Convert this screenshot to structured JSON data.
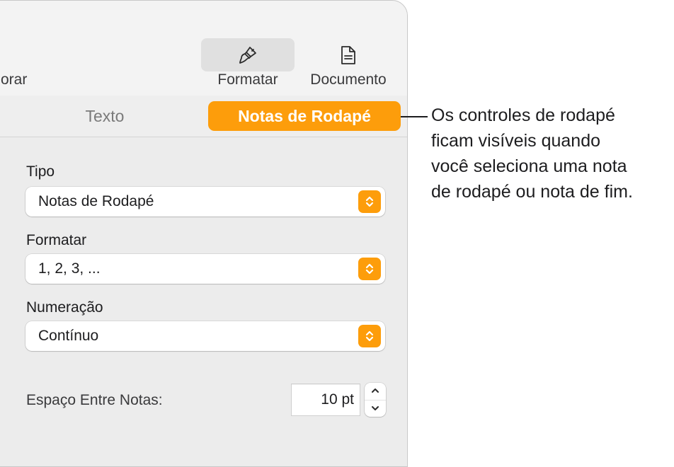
{
  "toolbar": {
    "partial_label": "orar",
    "buttons": [
      {
        "label": "Formatar",
        "icon": "paintbrush-icon",
        "active": true
      },
      {
        "label": "Documento",
        "icon": "document-icon",
        "active": false
      }
    ]
  },
  "tabs": [
    {
      "label": "Texto",
      "active": false
    },
    {
      "label": "Notas de Rodapé",
      "active": true
    }
  ],
  "fields": {
    "tipo": {
      "label": "Tipo",
      "value": "Notas de Rodapé"
    },
    "formatar": {
      "label": "Formatar",
      "value": "1, 2, 3, ..."
    },
    "numeracao": {
      "label": "Numeração",
      "value": "Contínuo"
    }
  },
  "spacing": {
    "label": "Espaço Entre Notas:",
    "value": "10 pt"
  },
  "callout": {
    "text": "Os controles de rodapé\nficam visíveis quando\nvocê seleciona uma nota\nde rodapé ou nota de fim."
  },
  "colors": {
    "accent": "#fd9d0b",
    "panel": "#ececec",
    "toolbar": "#f3f3f3"
  }
}
